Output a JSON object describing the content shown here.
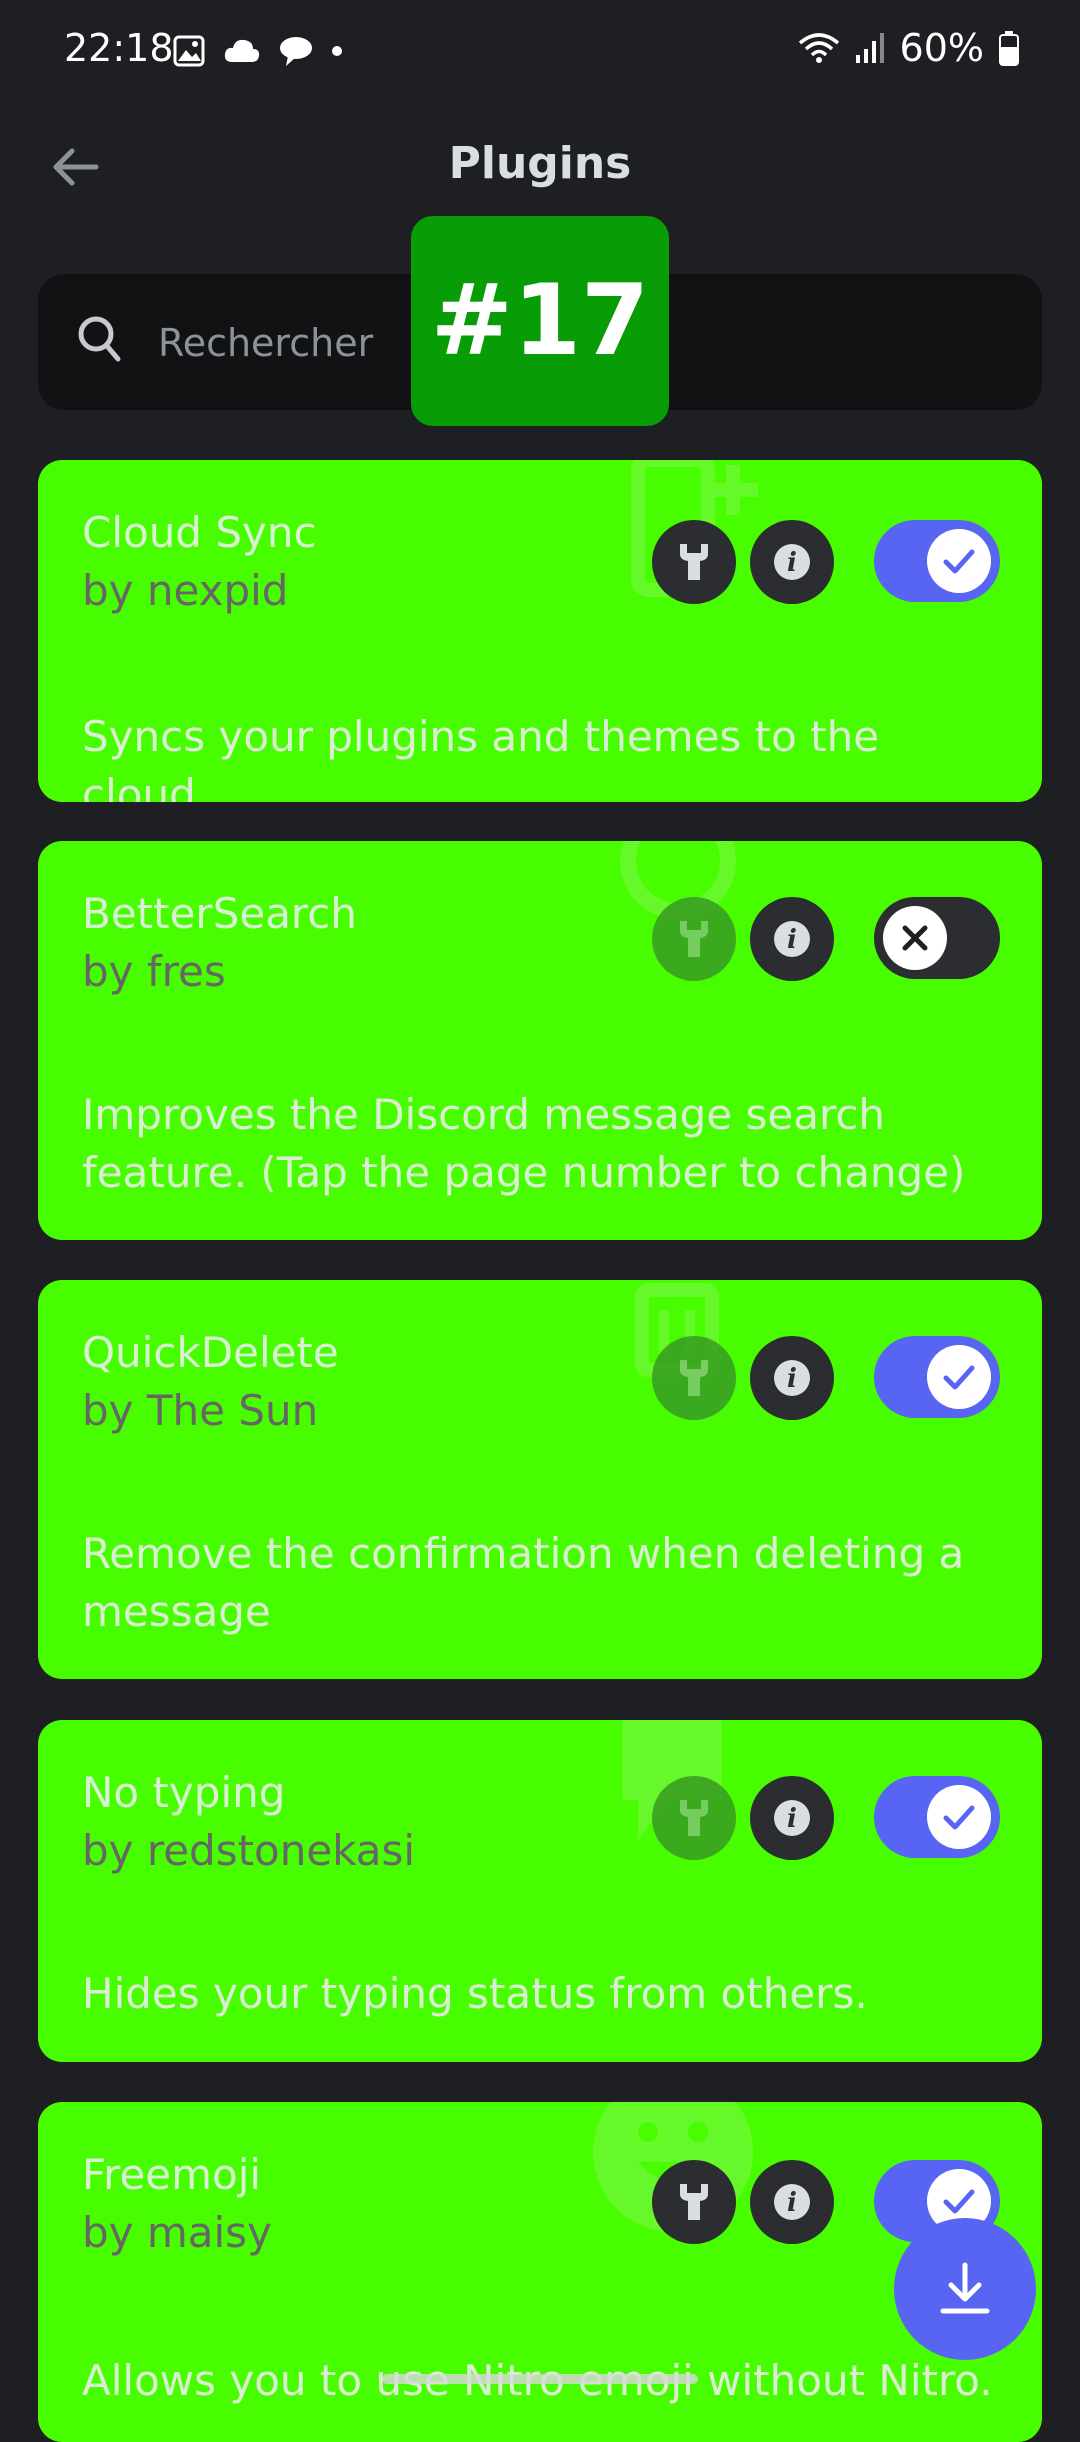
{
  "status_bar": {
    "time": "22:18",
    "battery": "60%"
  },
  "header": {
    "title": "Plugins"
  },
  "search": {
    "placeholder": "Rechercher"
  },
  "overlay_badge": "#17",
  "plugins": [
    {
      "name": "Cloud Sync",
      "author": "by nexpid",
      "description": "Syncs your plugins and themes to the cloud",
      "settings_enabled": true,
      "enabled": true
    },
    {
      "name": "BetterSearch",
      "author": "by fres",
      "description": "Improves the Discord message search feature. (Tap the page number to change)",
      "settings_enabled": false,
      "enabled": false
    },
    {
      "name": "QuickDelete",
      "author": "by The Sun",
      "description": "Remove the confirmation when deleting a message",
      "settings_enabled": false,
      "enabled": true
    },
    {
      "name": "No typing",
      "author": "by redstonekasi",
      "description": "Hides your typing status from others.",
      "settings_enabled": false,
      "enabled": true
    },
    {
      "name": "Freemoji",
      "author": "by maisy",
      "description": "Allows you to use Nitro emoji without Nitro.",
      "settings_enabled": true,
      "enabled": true
    }
  ],
  "colors": {
    "accent": "#5865f2",
    "card": "#48fd00",
    "background": "#1e1f22",
    "badge": "#089c06"
  }
}
